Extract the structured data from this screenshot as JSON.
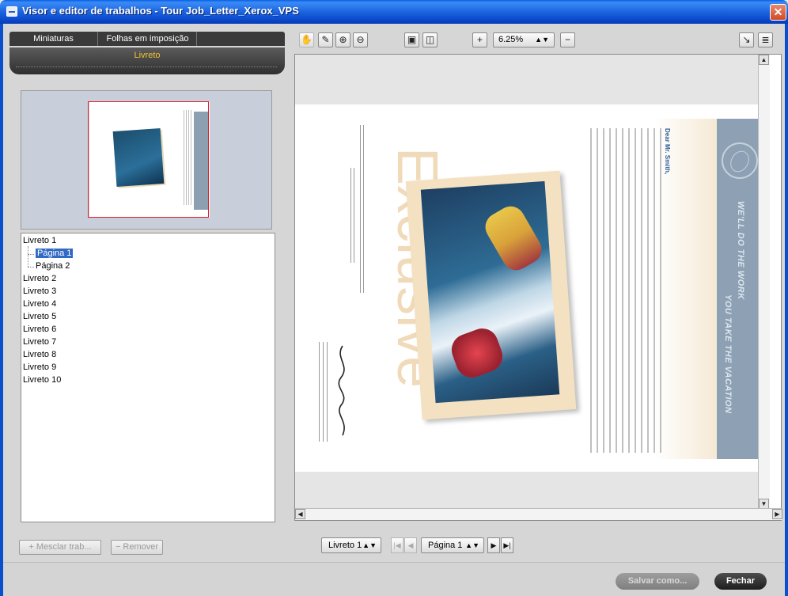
{
  "window": {
    "title": "Visor e editor de trabalhos - Tour Job_Letter_Xerox_VPS",
    "close_glyph": "✕"
  },
  "left": {
    "tabs": [
      "Miniaturas",
      "Folhas em imposição"
    ],
    "active_section": "Livreto",
    "tree": {
      "items": [
        "Livreto 1",
        "Página 1",
        "Página 2",
        "Livreto 2",
        "Livreto 3",
        "Livreto 4",
        "Livreto 5",
        "Livreto 6",
        "Livreto 7",
        "Livreto 8",
        "Livreto 9",
        "Livreto 10"
      ]
    },
    "buttons": {
      "merge": "+ Mesclar trab...",
      "remove": "− Remover"
    }
  },
  "toolbar": {
    "zoom_value": "6.25%",
    "icons": [
      "hand-icon",
      "eyedropper-icon",
      "zoom-in-icon",
      "zoom-out-icon",
      "fit-page-icon",
      "actual-size-icon",
      "plus-icon",
      "minus-icon",
      "rotate-icon",
      "text-select-icon"
    ]
  },
  "navigation": {
    "booklet": "Livreto 1",
    "page": "Página 1"
  },
  "document": {
    "headline": "Exclusive",
    "band_text_1": "WE'LL DO THE WORK",
    "band_text_2": "YOU TAKE THE VACATION",
    "salutation": "Dear Mr. Smith,"
  },
  "footer": {
    "save_as": "Salvar como...",
    "close": "Fechar"
  },
  "colors": {
    "titlebar": "#0A5FE8",
    "accent_yellow": "#F2C233",
    "selection": "#316AC5"
  }
}
